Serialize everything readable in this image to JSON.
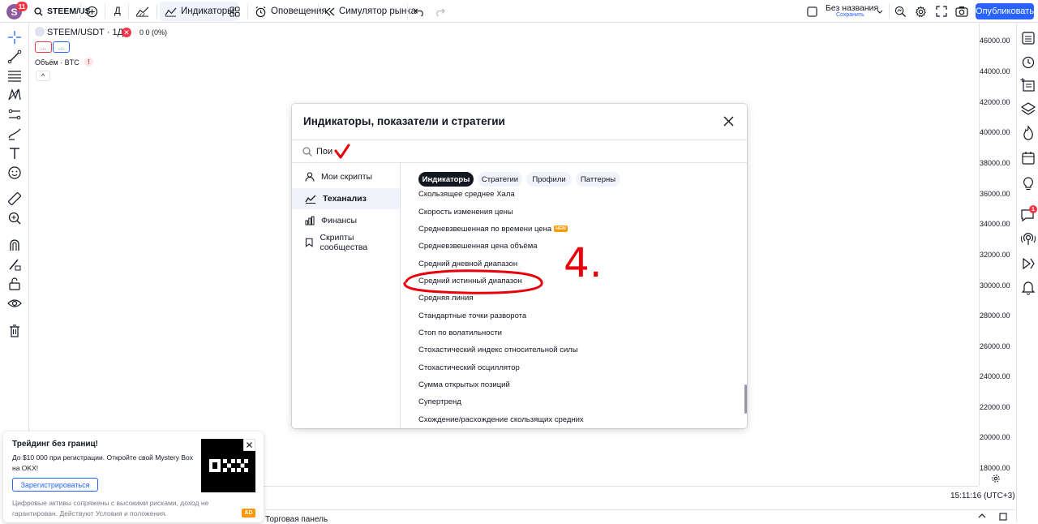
{
  "topbar": {
    "avatar_letter": "S",
    "avatar_badge": "11",
    "symbol": "STEEM/US",
    "interval": "Д",
    "indicators_label": "Индикаторы",
    "alerts_label": "Оповещения",
    "replay_label": "Симулятор рынка",
    "layout_name": "Без названия",
    "layout_status": "Сохранить",
    "publish_label": "Опубликовать"
  },
  "legend": {
    "symbol_title": "STEEM/USDT · 1Д",
    "change": "0  0 (0%)",
    "btn1": "...",
    "btn2": "...",
    "volume": "Объём · BTC",
    "collapse": "^"
  },
  "price_axis": {
    "labels": [
      "46000.00",
      "44000.00",
      "42000.00",
      "40000.00",
      "38000.00",
      "36000.00",
      "34000.00",
      "32000.00",
      "30000.00",
      "28000.00",
      "26000.00",
      "24000.00",
      "22000.00",
      "20000.00",
      "18000.00"
    ],
    "time": "15:11:16 (UTC+3)"
  },
  "modal": {
    "title": "Индикаторы, показатели и стратегии",
    "search_value": "Пои",
    "nav": [
      {
        "label": "Мои скрипты",
        "icon": "user-icon"
      },
      {
        "label": "Теханализ",
        "icon": "chart-analysis-icon"
      },
      {
        "label": "Финансы",
        "icon": "bar-chart-icon"
      },
      {
        "label": "Скрипты сообщества",
        "icon": "bookmark-icon"
      }
    ],
    "chips": [
      "Индикаторы",
      "Стратегии",
      "Профили",
      "Паттерны"
    ],
    "indicators": [
      "Скользящее среднее Хала",
      "Скорость изменения цены",
      "Средневзвешенная по времени цена",
      "Средневзвешенная цена объёма",
      "Средний дневной диапазон",
      "Средний истинный диапазон",
      "Средняя линия",
      "Стандартные точки разворота",
      "Стоп по волатильности",
      "Стохастический индекс относительной силы",
      "Стохастический осциллятор",
      "Сумма открытых позиций",
      "Супертренд",
      "Схождение/расхождение скользящих средних"
    ],
    "new_badge": "NEW",
    "annotation_number": "4."
  },
  "ad": {
    "title": "Трейдинг без границ!",
    "text": "До $10 000 при регистрации. Откройте свой Mystery Box на OKX!",
    "register": "Зарегистрироваться",
    "disclaimer": "Цифровые активы сопряжены с высокими рисками, доход не гарантирован. Действуют Условия и положения.",
    "badge": "AD",
    "logo": "OKX"
  },
  "bottom": {
    "trade_panel": "Торговая панель"
  },
  "colors": {
    "accent": "#2962ff",
    "annotation_red": "#e8000b",
    "avatar": "#8d5a9e"
  }
}
